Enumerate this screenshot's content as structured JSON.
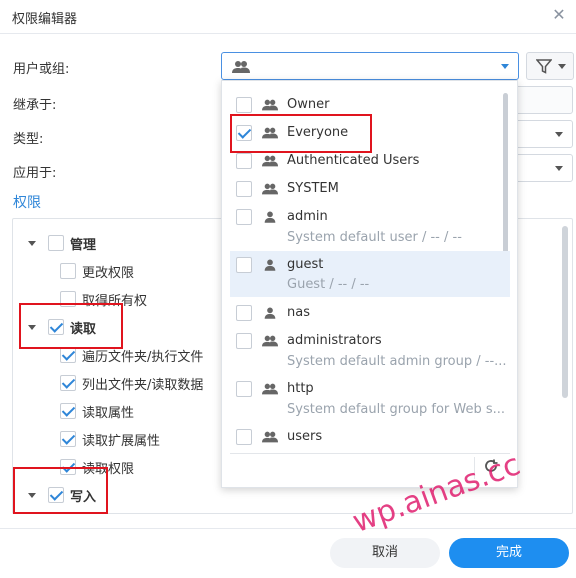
{
  "window": {
    "title": "权限编辑器"
  },
  "form": {
    "user_group_label": "用户或组:",
    "inherit_label": "继承于:",
    "type_label": "类型:",
    "apply_label": "应用于:"
  },
  "section": {
    "permissions_label": "权限"
  },
  "tree": {
    "manage": {
      "label": "管理",
      "checked": false,
      "children": [
        {
          "label": "更改权限",
          "checked": false
        },
        {
          "label": "取得所有权",
          "checked": false
        }
      ]
    },
    "read": {
      "label": "读取",
      "checked": true,
      "children": [
        {
          "label": "遍历文件夹/执行文件",
          "checked": true
        },
        {
          "label": "列出文件夹/读取数据",
          "checked": true
        },
        {
          "label": "读取属性",
          "checked": true
        },
        {
          "label": "读取扩展属性",
          "checked": true
        },
        {
          "label": "读取权限",
          "checked": true
        }
      ]
    },
    "write": {
      "label": "写入",
      "checked": true
    }
  },
  "dropdown": {
    "items": [
      {
        "name": "Owner",
        "sub": "",
        "icon": "group-icon",
        "checked": false
      },
      {
        "name": "Everyone",
        "sub": "",
        "icon": "group-icon",
        "checked": true
      },
      {
        "name": "Authenticated Users",
        "sub": "",
        "icon": "group-icon",
        "checked": false
      },
      {
        "name": "SYSTEM",
        "sub": "",
        "icon": "group-icon",
        "checked": false
      },
      {
        "name": "admin",
        "sub": "System default user / -- / --",
        "icon": "user-icon",
        "checked": false
      },
      {
        "name": "guest",
        "sub": "Guest / -- / --",
        "icon": "user-icon",
        "checked": false
      },
      {
        "name": "nas",
        "sub": "",
        "icon": "user-icon",
        "checked": false
      },
      {
        "name": "administrators",
        "sub": "System default admin group / --...",
        "icon": "group-icon",
        "checked": false
      },
      {
        "name": "http",
        "sub": "System default group for Web s...",
        "icon": "group-icon",
        "checked": false
      },
      {
        "name": "users",
        "sub": "",
        "icon": "group-icon",
        "checked": false
      }
    ]
  },
  "buttons": {
    "cancel": "取消",
    "ok": "完成"
  },
  "watermark": "wp.ainas.cc",
  "colors": {
    "accent": "#2f86d8",
    "primary_button": "#1e8ef0",
    "highlight_box": "#e0141e"
  }
}
